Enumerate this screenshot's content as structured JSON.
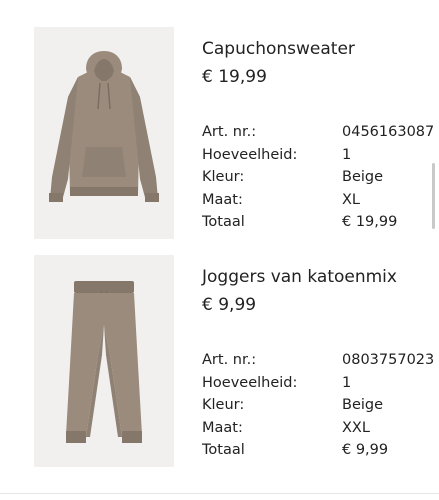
{
  "products": [
    {
      "name": "Capuchonsweater",
      "price": "€ 19,99",
      "image_icon": "hoodie-image",
      "details": [
        {
          "label": "Art. nr.:",
          "value": "0456163087"
        },
        {
          "label": "Hoeveelheid:",
          "value": "1"
        },
        {
          "label": "Kleur:",
          "value": "Beige"
        },
        {
          "label": "Maat:",
          "value": "XL"
        },
        {
          "label": "Totaal",
          "value": "€ 19,99"
        }
      ]
    },
    {
      "name": "Joggers van katoenmix",
      "price": "€ 9,99",
      "image_icon": "joggers-image",
      "details": [
        {
          "label": "Art. nr.:",
          "value": "0803757023"
        },
        {
          "label": "Hoeveelheid:",
          "value": "1"
        },
        {
          "label": "Kleur:",
          "value": "Beige"
        },
        {
          "label": "Maat:",
          "value": "XXL"
        },
        {
          "label": "Totaal",
          "value": "€ 9,99"
        }
      ]
    }
  ],
  "colors": {
    "garment": "#9a8b7d",
    "garment_shadow": "#85776a",
    "image_bg": "#f1f0ee",
    "text": "#222222"
  }
}
